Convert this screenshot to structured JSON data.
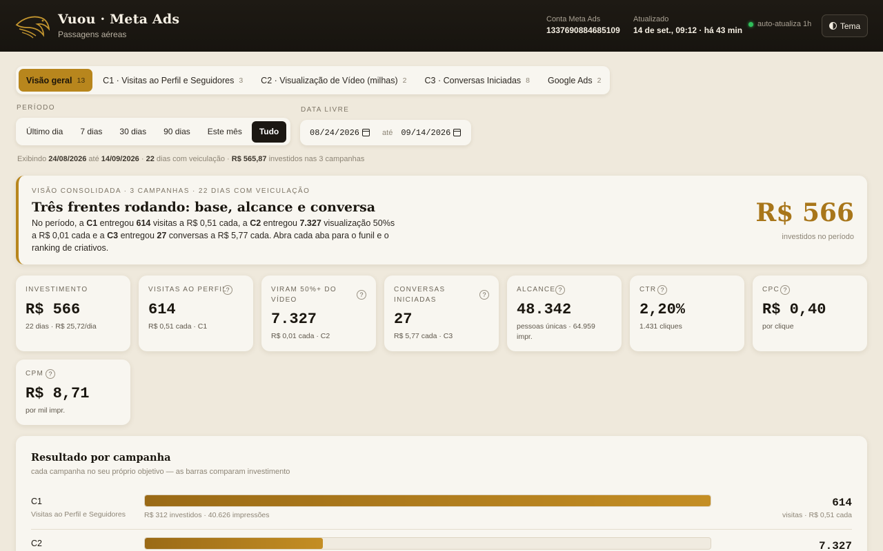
{
  "header": {
    "brand": "Vuou · Meta Ads",
    "subtitle": "Passagens aéreas",
    "account_label": "Conta Meta Ads",
    "account_id": "1337690884685109",
    "updated_label": "Atualizado",
    "updated_value": "14 de set., 09:12 · há 43 min",
    "auto_refresh": "auto-atualiza 1h",
    "theme_button": "Tema"
  },
  "tabs": [
    {
      "label": "Visão geral",
      "count": "13",
      "active": true
    },
    {
      "label": "C1 · Visitas ao Perfil e Seguidores",
      "count": "3"
    },
    {
      "label": "C2 · Visualização de Vídeo (milhas)",
      "count": "2"
    },
    {
      "label": "C3 · Conversas Iniciadas",
      "count": "8"
    },
    {
      "label": "Google Ads",
      "count": "2"
    }
  ],
  "period": {
    "label": "PERÍODO",
    "options": [
      "Último dia",
      "7 dias",
      "30 dias",
      "90 dias",
      "Este mês",
      "Tudo"
    ],
    "active": "Tudo"
  },
  "date_range": {
    "label": "DATA LIVRE",
    "from": "08/24/2026",
    "separator": "até",
    "to": "09/14/2026"
  },
  "showing": {
    "prefix": "Exibindo",
    "from": "24/08/2026",
    "until": "até",
    "to": "14/09/2026",
    "days": "22",
    "days_text": "dias com veiculação ·",
    "amount": "R$ 565,87",
    "amount_text": "investidos nas 3 campanhas"
  },
  "hero": {
    "kicker": "VISÃO CONSOLIDADA · 3 CAMPANHAS · 22 DIAS COM VEICULAÇÃO",
    "title": "Três frentes rodando: base, alcance e conversa",
    "t1": "No período, a ",
    "c1": "C1",
    "t2": " entregou ",
    "v1": "614",
    "t3": " visitas a R$ 0,51 cada, a ",
    "c2": "C2",
    "t4": " entregou ",
    "v2": "7.327",
    "t5": " visualização 50%s a R$ 0,01 cada e a ",
    "c3": "C3",
    "t6": " entregou ",
    "v3": "27",
    "t7": " conversas a R$ 5,77 cada. Abra cada aba para o funil e o ranking de criativos.",
    "amount": "R$ 566",
    "amount_sub": "investidos no período"
  },
  "kpis": [
    {
      "label": "INVESTIMENTO",
      "value": "R$ 566",
      "sub": "22 dias · R$ 25,72/dia",
      "help": false
    },
    {
      "label": "VISITAS AO PERFIL",
      "value": "614",
      "sub": "R$ 0,51 cada · C1",
      "help": true
    },
    {
      "label": "VIRAM 50%+ DO VÍDEO",
      "value": "7.327",
      "sub": "R$ 0,01 cada · C2",
      "help": true
    },
    {
      "label": "CONVERSAS INICIADAS",
      "value": "27",
      "sub": "R$ 5,77 cada · C3",
      "help": true
    },
    {
      "label": "ALCANCE",
      "value": "48.342",
      "sub": "pessoas únicas · 64.959 impr.",
      "help": true
    },
    {
      "label": "CTR",
      "value": "2,20%",
      "sub": "1.431 cliques",
      "help": true
    },
    {
      "label": "CPC",
      "value": "R$ 0,40",
      "sub": "por clique",
      "help": true
    },
    {
      "label": "CPM",
      "value": "R$ 8,71",
      "sub": "por mil impr.",
      "help": true
    }
  ],
  "help_glyph": "?",
  "results": {
    "title": "Resultado por campanha",
    "subtitle": "cada campanha no seu próprio objetivo — as barras comparam investimento",
    "rows": [
      {
        "name": "C1",
        "desc": "Visitas ao Perfil e Seguidores",
        "share": 1.0,
        "caption": "R$ 312 investidos · 40.626 impressões",
        "value": "614",
        "value_sub": "visitas · R$ 0,51 cada"
      },
      {
        "name": "C2",
        "desc": "",
        "share": 0.315,
        "caption": "",
        "value": "7.327",
        "value_sub": ""
      }
    ]
  },
  "colors": {
    "accent": "#b8861d",
    "dark": "#1b1712",
    "live": "#2fbf5a"
  }
}
